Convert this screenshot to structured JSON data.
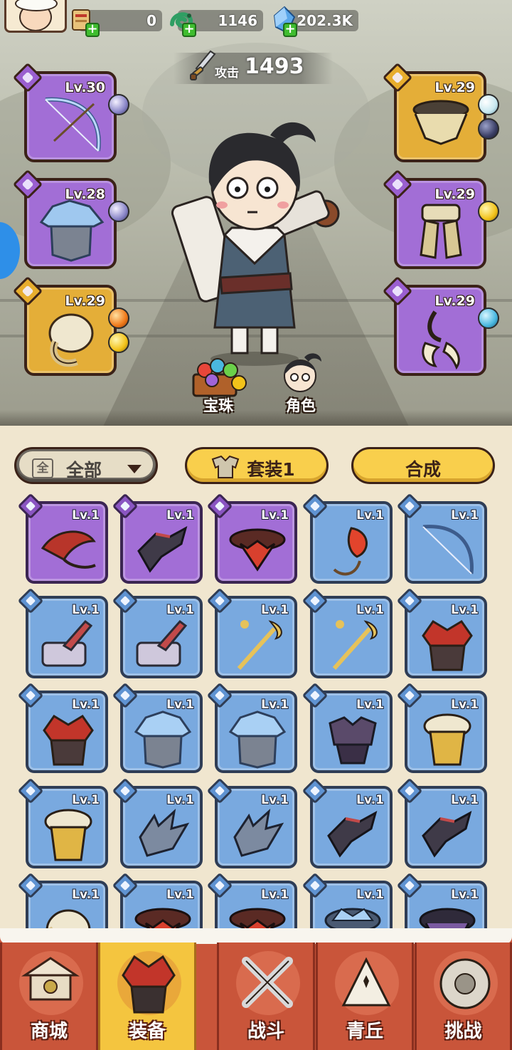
{
  "resources": {
    "scroll_count": "0",
    "jade_count": "1146",
    "crystal_count": "202.3K"
  },
  "attack": {
    "label": "攻击",
    "value": "1493"
  },
  "equipped_left": [
    {
      "level": "Lv.30",
      "rarity": "purple",
      "icon": "bow-icon"
    },
    {
      "level": "Lv.28",
      "rarity": "purple",
      "icon": "helmet-icon"
    },
    {
      "level": "Lv.29",
      "rarity": "gold",
      "icon": "gauntlet-icon"
    }
  ],
  "equipped_right": [
    {
      "level": "Lv.29",
      "rarity": "gold",
      "icon": "belt-icon"
    },
    {
      "level": "Lv.29",
      "rarity": "purple",
      "icon": "leg-armor-icon"
    },
    {
      "level": "Lv.29",
      "rarity": "purple",
      "icon": "claw-icon"
    }
  ],
  "scene_buttons": {
    "gems": "宝珠",
    "role": "角色"
  },
  "filter": {
    "all_box": "全",
    "label": "全部"
  },
  "buttons": {
    "set": "套装1",
    "merge": "合成"
  },
  "inventory": [
    {
      "level": "Lv.1",
      "rarity": "purple",
      "icon": "red-gauntlet-icon"
    },
    {
      "level": "Lv.1",
      "rarity": "purple",
      "icon": "dark-gauntlet-icon"
    },
    {
      "level": "Lv.1",
      "rarity": "purple",
      "icon": "red-belt-icon"
    },
    {
      "level": "Lv.1",
      "rarity": "blue",
      "icon": "fire-staff-icon"
    },
    {
      "level": "Lv.1",
      "rarity": "blue",
      "icon": "bow-icon"
    },
    {
      "level": "Lv.1",
      "rarity": "blue",
      "icon": "hammer-icon"
    },
    {
      "level": "Lv.1",
      "rarity": "blue",
      "icon": "hammer-icon"
    },
    {
      "level": "Lv.1",
      "rarity": "blue",
      "icon": "golden-staff-icon"
    },
    {
      "level": "Lv.1",
      "rarity": "blue",
      "icon": "golden-staff-icon"
    },
    {
      "level": "Lv.1",
      "rarity": "blue",
      "icon": "red-helmet-icon"
    },
    {
      "level": "Lv.1",
      "rarity": "blue",
      "icon": "red-helmet-icon"
    },
    {
      "level": "Lv.1",
      "rarity": "blue",
      "icon": "ice-helmet-icon"
    },
    {
      "level": "Lv.1",
      "rarity": "blue",
      "icon": "ice-helmet-icon"
    },
    {
      "level": "Lv.1",
      "rarity": "blue",
      "icon": "dark-armor-icon"
    },
    {
      "level": "Lv.1",
      "rarity": "blue",
      "icon": "gold-armor-icon"
    },
    {
      "level": "Lv.1",
      "rarity": "blue",
      "icon": "gold-armor-icon"
    },
    {
      "level": "Lv.1",
      "rarity": "blue",
      "icon": "steel-gauntlet-icon"
    },
    {
      "level": "Lv.1",
      "rarity": "blue",
      "icon": "steel-gauntlet-icon"
    },
    {
      "level": "Lv.1",
      "rarity": "blue",
      "icon": "dark-gauntlet-icon"
    },
    {
      "level": "Lv.1",
      "rarity": "blue",
      "icon": "dark-gauntlet-icon"
    },
    {
      "level": "Lv.1",
      "rarity": "blue",
      "icon": "bone-gauntlet-icon"
    },
    {
      "level": "Lv.1",
      "rarity": "blue",
      "icon": "red-belt-icon"
    },
    {
      "level": "Lv.1",
      "rarity": "blue",
      "icon": "red-belt-icon"
    },
    {
      "level": "Lv.1",
      "rarity": "blue",
      "icon": "ice-belt-icon"
    },
    {
      "level": "Lv.1",
      "rarity": "blue",
      "icon": "dark-belt-icon"
    }
  ],
  "nav": [
    {
      "label": "商城",
      "icon": "shop-icon",
      "active": false
    },
    {
      "label": "装备",
      "icon": "equipment-icon",
      "active": true
    },
    {
      "label": "战斗",
      "icon": "battle-icon",
      "active": false
    },
    {
      "label": "青丘",
      "icon": "mountain-icon",
      "active": false
    },
    {
      "label": "挑战",
      "icon": "challenge-icon",
      "active": false
    }
  ],
  "colors": {
    "purple_rarity": "#a26ed6",
    "gold_rarity": "#e4ae38",
    "blue_rarity": "#79a9df",
    "nav_bg": "#c9553a",
    "nav_active": "#f4c53f",
    "button_yellow": "#f9cf4c"
  }
}
